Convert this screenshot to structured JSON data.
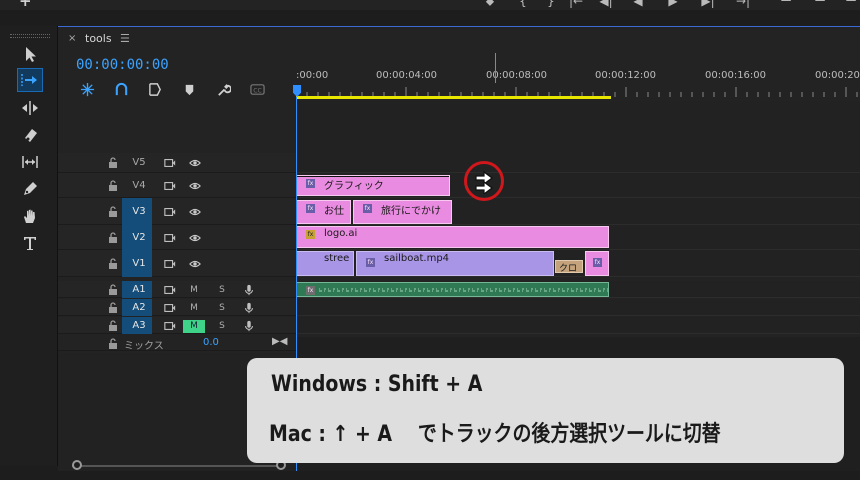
{
  "top_bar": {
    "add_label": "+",
    "controls": [
      "marker-icon",
      "go-to-in-icon",
      "go-to-out-icon",
      "go-back-icon",
      "step-back-icon",
      "play-icon",
      "step-forward-icon",
      "go-forward-icon",
      "lift-icon",
      "extract-icon",
      "export-frame-icon"
    ]
  },
  "tools": {
    "items": [
      {
        "name": "selection-tool",
        "icon": "arrow-icon",
        "active": false
      },
      {
        "name": "track-select-backward-tool",
        "icon": "track-select-backward-icon",
        "active": true
      },
      {
        "name": "ripple-edit-tool",
        "icon": "ripple-edit-icon",
        "active": false
      },
      {
        "name": "razor-tool",
        "icon": "razor-icon",
        "active": false
      },
      {
        "name": "slip-tool",
        "icon": "slip-icon",
        "active": false
      },
      {
        "name": "pen-tool",
        "icon": "pen-icon",
        "active": false
      },
      {
        "name": "hand-tool",
        "icon": "hand-icon",
        "active": false
      },
      {
        "name": "type-tool",
        "icon": "type-icon",
        "active": false
      }
    ]
  },
  "panel": {
    "tab_close": "×",
    "tab_title": "tools",
    "tab_menu": "☰",
    "timecode": "00:00:00:00",
    "header_icons": [
      "snap-icon",
      "linked-selection-icon",
      "add-marker-icon",
      "marker-icon",
      "settings-wrench-icon",
      "captions-icon"
    ],
    "header_cc_label": "CC"
  },
  "ruler": {
    "labels": [
      ":00:00",
      "00:00:04:00",
      "00:00:08:00",
      "00:00:12:00",
      "00:00:16:00",
      "00:00:20"
    ]
  },
  "tracks": [
    {
      "id": "V5",
      "kind": "video",
      "targeted": false
    },
    {
      "id": "V4",
      "kind": "video",
      "targeted": false
    },
    {
      "id": "V3",
      "kind": "video",
      "targeted": true
    },
    {
      "id": "V2",
      "kind": "video",
      "targeted": true
    },
    {
      "id": "V1",
      "kind": "video",
      "targeted": true
    },
    {
      "id": "A1",
      "kind": "audio",
      "targeted": true,
      "m": "M",
      "s": "S",
      "muted": false
    },
    {
      "id": "A2",
      "kind": "audio",
      "targeted": true,
      "m": "M",
      "s": "S",
      "muted": false
    },
    {
      "id": "A3",
      "kind": "audio",
      "targeted": true,
      "m": "M",
      "s": "S",
      "muted": true
    }
  ],
  "mix": {
    "label": "ミックス",
    "value": "0.0"
  },
  "clips": {
    "v4_graphic": "グラフィック",
    "v3_a": "お仕",
    "v3_b": "旅行にでかけ",
    "v2_logo": "logo.ai",
    "v1_stree": "stree",
    "v1_sailboat": "sailboat.mp4",
    "v1_cross": "クロ",
    "fx": "fx"
  },
  "caption": {
    "line1": "Windows : Shift + A",
    "line2_prefix": "Mac : ↑ + A",
    "line2_suffix": "でトラックの後方選択ツールに切替"
  },
  "colors": {
    "timecode": "#3aa3ff",
    "video_clip": "#e98be0",
    "video_clip_alt": "#a995e6",
    "audio_clip": "#2f7a55",
    "work_area": "#e6e600",
    "annotation_circle": "#d0171c",
    "target_active": "#144d7a",
    "mute_on": "#3fd38a"
  }
}
